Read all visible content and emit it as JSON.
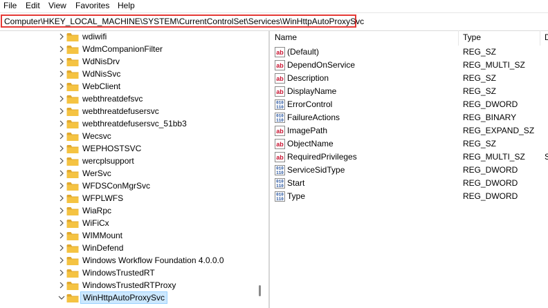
{
  "menubar": {
    "items": [
      "File",
      "Edit",
      "View",
      "Favorites",
      "Help"
    ]
  },
  "address": {
    "path": "Computer\\HKEY_LOCAL_MACHINE\\SYSTEM\\CurrentControlSet\\Services\\WinHttpAutoProxySvc"
  },
  "tree": {
    "items": [
      {
        "label": "wdiwifi"
      },
      {
        "label": "WdmCompanionFilter"
      },
      {
        "label": "WdNisDrv"
      },
      {
        "label": "WdNisSvc"
      },
      {
        "label": "WebClient"
      },
      {
        "label": "webthreatdefsvc"
      },
      {
        "label": "webthreatdefusersvc"
      },
      {
        "label": "webthreatdefusersvc_51bb3"
      },
      {
        "label": "Wecsvc"
      },
      {
        "label": "WEPHOSTSVC"
      },
      {
        "label": "wercplsupport"
      },
      {
        "label": "WerSvc"
      },
      {
        "label": "WFDSConMgrSvc"
      },
      {
        "label": "WFPLWFS"
      },
      {
        "label": "WiaRpc"
      },
      {
        "label": "WiFiCx"
      },
      {
        "label": "WIMMount"
      },
      {
        "label": "WinDefend"
      },
      {
        "label": "Windows Workflow Foundation 4.0.0.0"
      },
      {
        "label": "WindowsTrustedRT"
      },
      {
        "label": "WindowsTrustedRTProxy"
      },
      {
        "label": "WinHttpAutoProxySvc",
        "selected": true,
        "expanded": true
      }
    ]
  },
  "list": {
    "columns": {
      "name": "Name",
      "type": "Type",
      "data": "D"
    },
    "values": [
      {
        "icon": "string-value-icon",
        "name": "(Default)",
        "type": "REG_SZ",
        "data": ""
      },
      {
        "icon": "string-value-icon",
        "name": "DependOnService",
        "type": "REG_MULTI_SZ",
        "data": ""
      },
      {
        "icon": "string-value-icon",
        "name": "Description",
        "type": "REG_SZ",
        "data": ""
      },
      {
        "icon": "string-value-icon",
        "name": "DisplayName",
        "type": "REG_SZ",
        "data": ""
      },
      {
        "icon": "binary-value-icon",
        "name": "ErrorControl",
        "type": "REG_DWORD",
        "data": ""
      },
      {
        "icon": "binary-value-icon",
        "name": "FailureActions",
        "type": "REG_BINARY",
        "data": ""
      },
      {
        "icon": "string-value-icon",
        "name": "ImagePath",
        "type": "REG_EXPAND_SZ",
        "data": ""
      },
      {
        "icon": "string-value-icon",
        "name": "ObjectName",
        "type": "REG_SZ",
        "data": ""
      },
      {
        "icon": "string-value-icon",
        "name": "RequiredPrivileges",
        "type": "REG_MULTI_SZ",
        "data": "S"
      },
      {
        "icon": "binary-value-icon",
        "name": "ServiceSidType",
        "type": "REG_DWORD",
        "data": ""
      },
      {
        "icon": "binary-value-icon",
        "name": "Start",
        "type": "REG_DWORD",
        "data": ""
      },
      {
        "icon": "binary-value-icon",
        "name": "Type",
        "type": "REG_DWORD",
        "data": ""
      }
    ]
  },
  "colors": {
    "folder": "#f5c342",
    "selection_bg": "#cce8ff",
    "selection_border": "#99d1ff",
    "address_highlight": "#e53935",
    "string_icon": "#c8102e",
    "binary_icon": "#1f4e9c"
  }
}
